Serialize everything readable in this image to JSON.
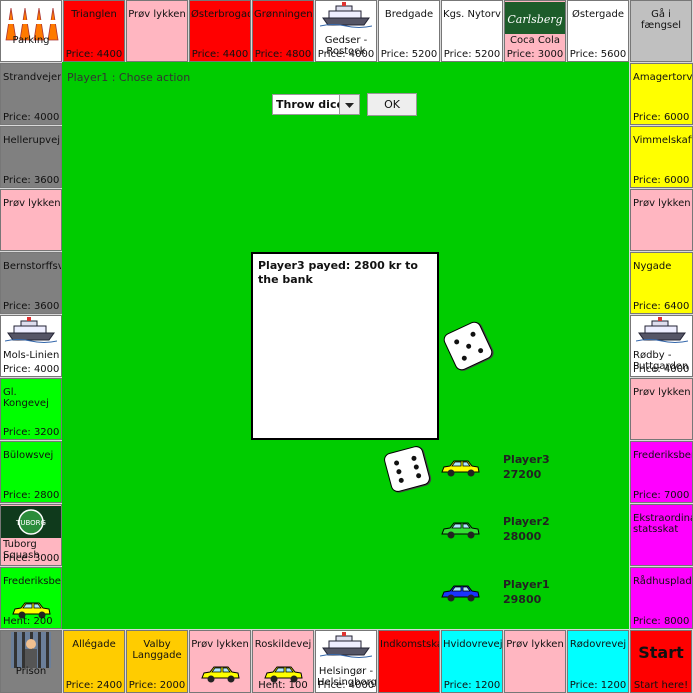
{
  "status": "Player1 : Chose action",
  "controls": {
    "dice_select": "Throw dice",
    "ok": "OK"
  },
  "message": "Player3 payed: 2800 kr to the bank",
  "dice": [
    {
      "label": "die-1",
      "value": 5
    },
    {
      "label": "die-2",
      "value": 6
    }
  ],
  "players": [
    {
      "name": "Player3",
      "money": "27200",
      "color": "#ffff00"
    },
    {
      "name": "Player2",
      "money": "28000",
      "color": "#33dd33"
    },
    {
      "name": "Player1",
      "money": "29800",
      "color": "#1a33ff"
    }
  ],
  "top": [
    {
      "name": "Parking",
      "price": "",
      "color": "#ffffff",
      "icon": "traffic-cones-icon"
    },
    {
      "name": "Trianglen",
      "price": "Price: 4400",
      "color": "#ff0000"
    },
    {
      "name": "Prøv lykken",
      "price": "",
      "color": "#ffb6c1"
    },
    {
      "name": "Østerbrogade",
      "price": "Price: 4400",
      "color": "#ff0000"
    },
    {
      "name": "Grønningen",
      "price": "Price: 4800",
      "color": "#ff0000"
    },
    {
      "name": "Gedser - Rostock",
      "price": "Price: 4000",
      "color": "#ffffff",
      "icon": "ferry-icon"
    },
    {
      "name": "Bredgade",
      "price": "Price: 5200",
      "color": "#ffffff"
    },
    {
      "name": "Kgs. Nytorv",
      "price": "Price: 5200",
      "color": "#ffffff"
    },
    {
      "name": "Coca Cola",
      "price": "Price: 3000",
      "color": "#ffb6c1",
      "icon": "carlsberg-logo-icon"
    },
    {
      "name": "Østergade",
      "price": "Price: 5600",
      "color": "#ffffff"
    },
    {
      "name": "Gå i fængsel",
      "price": "",
      "color": "#c0c0c0"
    }
  ],
  "left": [
    {
      "name": "Strandvejen",
      "price": "Price: 4000",
      "color": "#808080"
    },
    {
      "name": "Hellerupvej",
      "price": "Price: 3600",
      "color": "#808080"
    },
    {
      "name": "Prøv lykken",
      "price": "",
      "color": "#ffb6c1"
    },
    {
      "name": "Bernstorffsvej",
      "price": "Price: 3600",
      "color": "#808080"
    },
    {
      "name": "Mols-Linien",
      "price": "Price: 4000",
      "color": "#ffffff",
      "icon": "ferry-icon"
    },
    {
      "name": "Gl. Kongevej",
      "price": "Price: 3200",
      "color": "#00ff00"
    },
    {
      "name": "Bülowsvej",
      "price": "Price: 2800",
      "color": "#00ff00"
    },
    {
      "name": "Tuborg Squash",
      "price": "Price: 3000",
      "color": "#ffb6c1",
      "icon": "tuborg-logo-icon"
    },
    {
      "name": "Frederiksberg",
      "price": "Hent: 200",
      "color": "#00ff00",
      "icon": "car-icon"
    }
  ],
  "right": [
    {
      "name": "Amagertorv",
      "price": "Price: 6000",
      "color": "#ffff00"
    },
    {
      "name": "Vimmelskaftet",
      "price": "Price: 6000",
      "color": "#ffff00"
    },
    {
      "name": "Prøv lykken",
      "price": "",
      "color": "#ffb6c1"
    },
    {
      "name": "Nygade",
      "price": "Price: 6400",
      "color": "#ffff00"
    },
    {
      "name": "Rødby - Puttgarden",
      "price": "Price: 4000",
      "color": "#ffffff",
      "icon": "ferry-icon"
    },
    {
      "name": "Prøv lykken",
      "price": "",
      "color": "#ffb6c1"
    },
    {
      "name": "Frederiksberg",
      "price": "Price: 7000",
      "color": "#ff00ff"
    },
    {
      "name": "Ekstraordinær statsskat",
      "price": "",
      "color": "#ff00ff"
    },
    {
      "name": "Rådhuspladsen",
      "price": "Price: 8000",
      "color": "#ff00ff"
    }
  ],
  "bottom": [
    {
      "name": "Prison",
      "price": "",
      "color": "#808080",
      "icon": "prison-bars-icon"
    },
    {
      "name": "Allégade",
      "price": "Price: 2400",
      "color": "#ffcc00"
    },
    {
      "name": "Valby Langgade",
      "price": "Price: 2000",
      "color": "#ffcc00"
    },
    {
      "name": "Prøv lykken",
      "price": "",
      "color": "#ffb6c1",
      "icon": "car-icon"
    },
    {
      "name": "Roskildevej",
      "price": "Hent: 100",
      "color": "#ffb6c1",
      "icon": "car-icon"
    },
    {
      "name": "Helsingør - Helsingborg",
      "price": "Price: 4000",
      "color": "#ffffff",
      "icon": "ferry-icon"
    },
    {
      "name": "Indkomstskat",
      "price": "",
      "color": "#ff0000"
    },
    {
      "name": "Hvidovrevej",
      "price": "Price: 1200",
      "color": "#00ffff"
    },
    {
      "name": "Prøv lykken",
      "price": "",
      "color": "#ffb6c1"
    },
    {
      "name": "Rødovrevej",
      "price": "Price: 1200",
      "color": "#00ffff"
    },
    {
      "name": "Start",
      "price": "Start here!",
      "color": "#ff0000"
    }
  ]
}
